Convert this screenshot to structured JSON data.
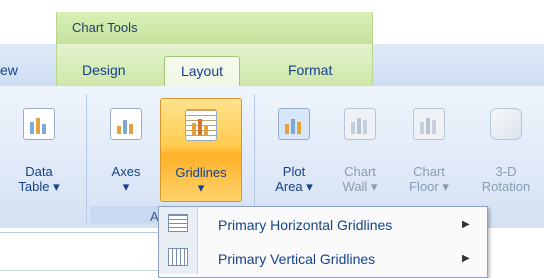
{
  "contextual_header": {
    "title": "Chart Tools"
  },
  "tabs": [
    {
      "label": "ew"
    },
    {
      "label": "Design"
    },
    {
      "label": "Layout",
      "active": true
    },
    {
      "label": "Format"
    }
  ],
  "buttons": {
    "data_table": {
      "line1": "Data",
      "line2": "Table ▾"
    },
    "axes": {
      "line1": "Axes",
      "line2": "▾"
    },
    "gridlines": {
      "line1": "Gridlines",
      "line2": "▾"
    },
    "plot_area": {
      "line1": "Plot",
      "line2": "Area ▾"
    },
    "chart_wall": {
      "line1": "Chart",
      "line2": "Wall ▾"
    },
    "chart_floor": {
      "line1": "Chart",
      "line2": "Floor ▾"
    },
    "rotation_3d": {
      "line1": "3-D",
      "line2": "Rotation"
    }
  },
  "group_label": "A",
  "menu": {
    "items": [
      {
        "label": "Primary Horizontal Gridlines",
        "icon": "horizontal-gridlines-icon",
        "submenu_arrow": "▶"
      },
      {
        "label": "Primary Vertical Gridlines",
        "icon": "vertical-gridlines-icon",
        "submenu_arrow": "▶"
      }
    ]
  },
  "colors": {
    "accent_selected": "#ffcc4f",
    "context_green": "#c6e39d",
    "text_blue": "#15428b"
  }
}
